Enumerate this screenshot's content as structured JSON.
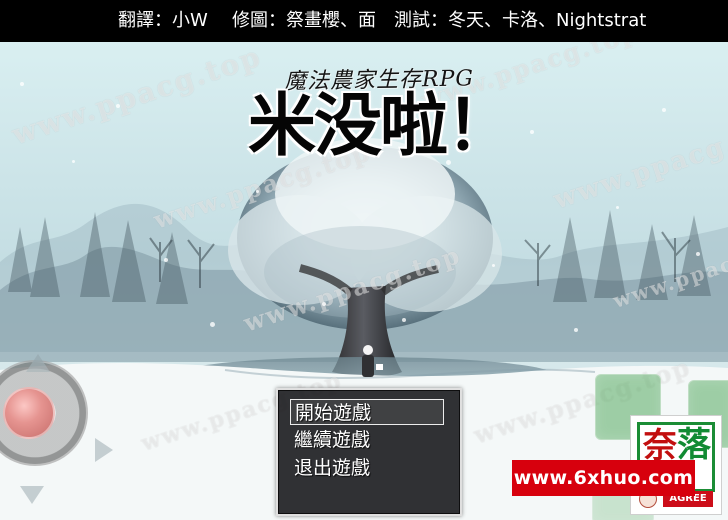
{
  "top_banner": {
    "translation_label": "翻譯：",
    "translation_value": "小W",
    "edit_label": "修圖：",
    "edit_value": "祭畫櫻、面",
    "test_label": "測試：",
    "test_value": "冬天、卡洛、Nightstrat"
  },
  "title_screen": {
    "subtitle": "魔法農家生存RPG",
    "main_title": "米没啦！"
  },
  "menu": {
    "items": [
      {
        "label": "開始遊戲"
      },
      {
        "label": "繼續遊戲"
      },
      {
        "label": "退出遊戲"
      }
    ]
  },
  "watermarks": [
    "www.ppacg.top",
    "www.ppacg.top",
    "www.ppacg.top",
    "www.ppacg.top",
    "www.ppacg.top",
    "www.ppacg.top",
    "www.ppacg.top",
    "www.ppacg.top"
  ],
  "ad_banner": {
    "text": "www.6xhuo.com"
  },
  "logo": {
    "red_char": "奈",
    "green_char": "落",
    "bottom_text": "AGREE"
  },
  "colors": {
    "accent_red": "#d7000d",
    "button_green": "#55aa60",
    "title_black": "#050505",
    "menu_bg": "#141418"
  },
  "icons": {
    "dpad": "directional-pad-icon",
    "up_arrow": "up-arrow-icon",
    "right_arrow": "right-arrow-icon",
    "down_arrow": "down-arrow-icon"
  }
}
